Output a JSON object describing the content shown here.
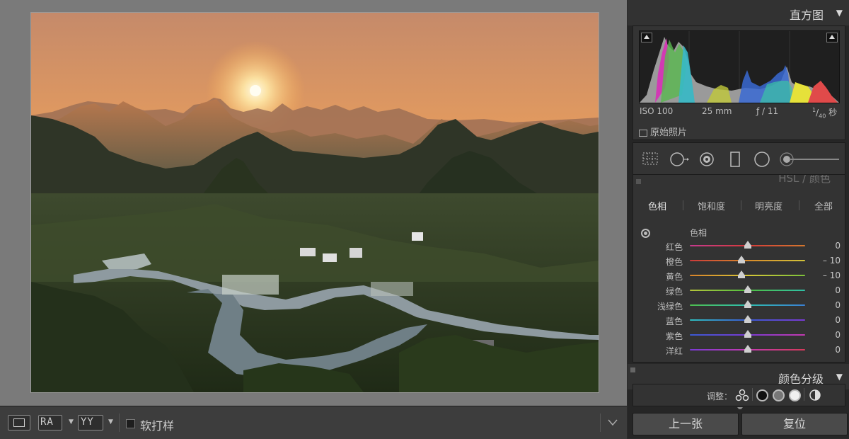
{
  "viewer": {
    "toolbar": {
      "view_mode_icon": "loupe-view-icon",
      "before_after_icon": "RA",
      "yy_icon": "YY",
      "soft_proof_label": "软打样",
      "collapse_icon": "chevron-down-icon"
    }
  },
  "panel": {
    "histogram": {
      "title": "直方图",
      "iso": "ISO 100",
      "focal": "25 mm",
      "aperture": "ƒ / 11",
      "shutter_num": "1",
      "shutter_den": "40",
      "shutter_unit": "秒",
      "original_photo_label": "原始照片"
    },
    "hsl": {
      "partial_title": "HSL / 颜色",
      "tabs": [
        "色相",
        "饱和度",
        "明亮度",
        "全部"
      ],
      "active_tab": "色相",
      "subheading": "色相",
      "sliders": [
        {
          "label": "红色",
          "value": "0",
          "num": 0,
          "gradient": "linear-gradient(90deg,#c53a8e,#d63a3a,#d4782e)"
        },
        {
          "label": "橙色",
          "value": "– 10",
          "num": -10,
          "gradient": "linear-gradient(90deg,#cc3a3a,#d98a2a,#d2c43a)"
        },
        {
          "label": "黄色",
          "value": "– 10",
          "num": -10,
          "gradient": "linear-gradient(90deg,#d9822a,#d8c637,#7cc23a)"
        },
        {
          "label": "绿色",
          "value": "0",
          "num": 0,
          "gradient": "linear-gradient(90deg,#b6c43a,#4fbf3f,#2fbfa6)"
        },
        {
          "label": "浅绿色",
          "value": "0",
          "num": 0,
          "gradient": "linear-gradient(90deg,#4ebf4e,#2fbfb0,#3a7fd4)"
        },
        {
          "label": "蓝色",
          "value": "0",
          "num": 0,
          "gradient": "linear-gradient(90deg,#2fbfbf,#3a5ad4,#7a3ad4)"
        },
        {
          "label": "紫色",
          "value": "0",
          "num": 0,
          "gradient": "linear-gradient(90deg,#3a5ad4,#7a3ad4,#c43ab0)"
        },
        {
          "label": "洋红",
          "value": "0",
          "num": 0,
          "gradient": "linear-gradient(90deg,#7a3ad4,#c43ab0,#d43a5a)"
        }
      ]
    },
    "color_grading": {
      "title": "颜色分级",
      "adjust_label": "调整："
    },
    "nav": {
      "prev_label": "上一张",
      "reset_label": "复位"
    }
  }
}
